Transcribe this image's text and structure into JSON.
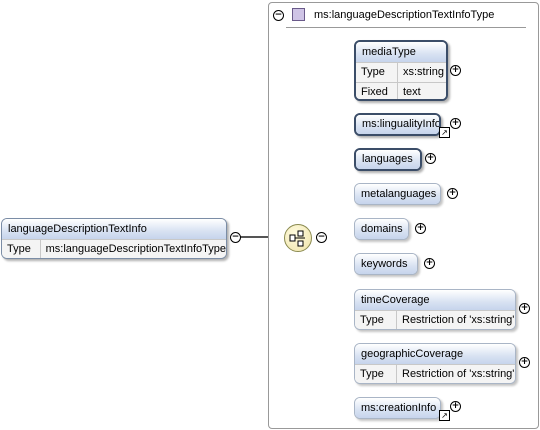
{
  "type_panel": {
    "title": "ms:languageDescriptionTextInfoType",
    "collapse_glyph": "−"
  },
  "root_element": {
    "name": "languageDescriptionTextInfo",
    "type_key": "Type",
    "type_value": "ms:languageDescriptionTextInfoType",
    "collapse_glyph": "−"
  },
  "sequence": {
    "icon": "sequence-compositor-icon",
    "collapse_glyph": "−"
  },
  "children": [
    {
      "name": "mediaType",
      "type_key": "Type",
      "type_value": "xs:string",
      "fixed_key": "Fixed",
      "fixed_value": "text",
      "expand": "+"
    },
    {
      "name": "ms:lingualityInfo",
      "expand": "+",
      "ref_glyph": "↗"
    },
    {
      "name": "languages",
      "expand": "+"
    },
    {
      "name": "metalanguages",
      "expand": "+"
    },
    {
      "name": "domains",
      "expand": "+"
    },
    {
      "name": "keywords",
      "expand": "+"
    },
    {
      "name": "timeCoverage",
      "type_key": "Type",
      "type_value": "Restriction of 'xs:string'",
      "expand": "+"
    },
    {
      "name": "geographicCoverage",
      "type_key": "Type",
      "type_value": "Restriction of 'xs:string'",
      "expand": "+"
    },
    {
      "name": "ms:creationInfo",
      "expand": "+",
      "ref_glyph": "↗"
    }
  ],
  "colors": {
    "header_gradient_end": "#c6d4ec",
    "border": "#7b8da6",
    "connector": "#555555"
  }
}
